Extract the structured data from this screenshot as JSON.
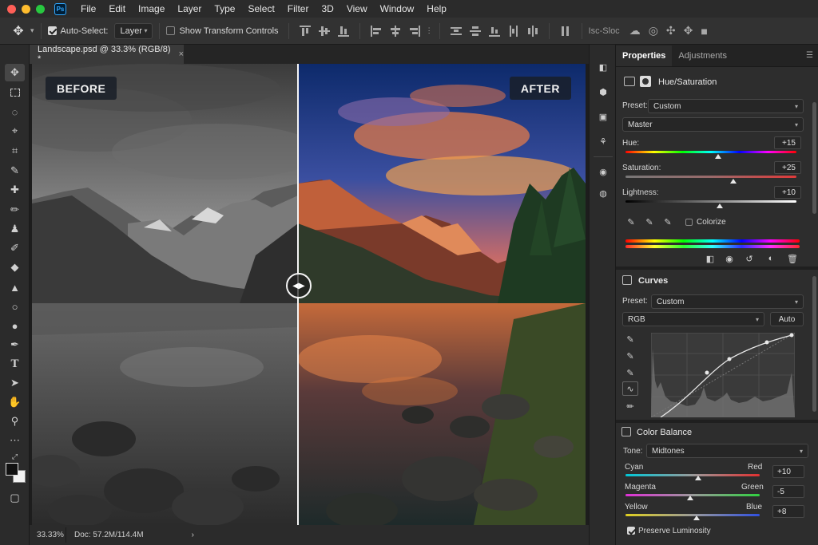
{
  "menubar": {
    "app_badge": "Ps",
    "items": [
      "File",
      "Edit",
      "Image",
      "Layer",
      "Type",
      "Select",
      "Filter",
      "3D",
      "View",
      "Window",
      "Help"
    ],
    "traffic_colors": [
      "#fe5f57",
      "#febc2e",
      "#28c840"
    ]
  },
  "options": {
    "auto_select_label": "Auto-Select:",
    "auto_select_checked": true,
    "auto_select_target": "Layer",
    "show_transform_label": "Show Transform Controls",
    "show_transform_checked": false,
    "iso_label": "Isc-Sloc"
  },
  "document": {
    "tab_title": "Landscape.psd @ 33.3% (RGB/8) *",
    "before_label": "BEFORE",
    "after_label": "AFTER"
  },
  "status": {
    "zoom": "33.33%",
    "doc_info": "Doc: 57.2M/114.4M"
  },
  "panel": {
    "tabs": [
      "Properties",
      "Adjustments"
    ],
    "hue_sat": {
      "title": "Hue/Saturation",
      "preset_label": "Preset:",
      "preset_value": "Custom",
      "channel": "Master",
      "hue_label": "Hue:",
      "hue_value": "+15",
      "hue_pos": 0.54,
      "sat_label": "Saturation:",
      "sat_value": "+25",
      "sat_pos": 0.63,
      "light_label": "Lightness:",
      "light_value": "+10",
      "light_pos": 0.55,
      "colorize_label": "Colorize",
      "colorize_checked": false
    },
    "curves": {
      "title": "Curves",
      "preset_label": "Preset:",
      "preset_value": "Custom",
      "channel": "RGB",
      "auto_label": "Auto"
    },
    "color_balance": {
      "title": "Color Balance",
      "tone_label": "Tone:",
      "tone_value": "Midtones",
      "sliders": [
        {
          "left": "Cyan",
          "right": "Red",
          "value": "+10",
          "pos": 0.54
        },
        {
          "left": "Magenta",
          "right": "Green",
          "value": "-5",
          "pos": 0.48
        },
        {
          "left": "Yellow",
          "right": "Blue",
          "value": "+8",
          "pos": 0.53
        }
      ],
      "preserve_label": "Preserve Luminosity",
      "preserve_checked": true
    }
  },
  "colors": {
    "accent": "#31a8ff",
    "panel_bg": "#2d2d2d",
    "foreground_swatch": "#111111",
    "background_swatch": "#f2f2f2"
  }
}
